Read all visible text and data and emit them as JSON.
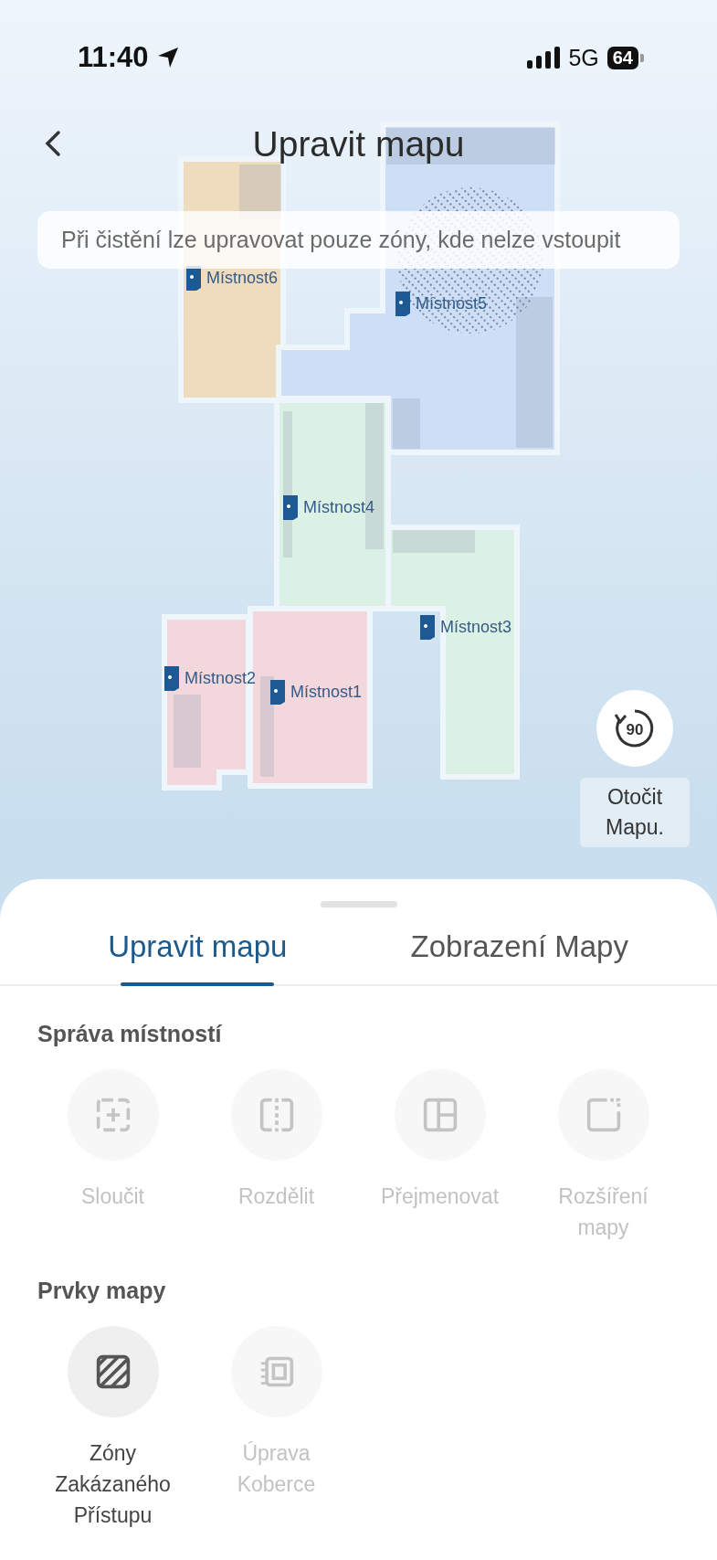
{
  "status_bar": {
    "time": "11:40",
    "network": "5G",
    "battery": "64"
  },
  "header": {
    "title": "Upravit mapu"
  },
  "notice": "Při čistění lze upravovat pouze zóny, kde nelze vstoupit",
  "map": {
    "rooms": [
      {
        "name": "Místnost6",
        "color": "#efdcbf"
      },
      {
        "name": "Místnost5",
        "color": "#cddff7"
      },
      {
        "name": "Místnost4",
        "color": "#dcf1e6"
      },
      {
        "name": "Místnost3",
        "color": "#dcf1e6"
      },
      {
        "name": "Místnost2",
        "color": "#f2d8dd"
      },
      {
        "name": "Místnost1",
        "color": "#f2d8dd"
      }
    ]
  },
  "rotate": {
    "badge": "90",
    "label": "Otočit Mapu."
  },
  "tabs": [
    {
      "label": "Upravit mapu",
      "selected": true
    },
    {
      "label": "Zobrazení Mapy",
      "selected": false
    }
  ],
  "sections": [
    {
      "title": "Správa místností",
      "tools": [
        {
          "label": "Sloučit",
          "kind": "merge",
          "disabled": true
        },
        {
          "label": "Rozdělit",
          "kind": "split",
          "disabled": true
        },
        {
          "label": "Přejmenovat",
          "kind": "rename",
          "disabled": true
        },
        {
          "label": "Rozšíření mapy",
          "kind": "expand",
          "disabled": true
        }
      ]
    },
    {
      "title": "Prvky mapy",
      "tools": [
        {
          "label": "Zóny Zakázaného Přístupu",
          "kind": "nogo",
          "disabled": false
        },
        {
          "label": "Úprava Koberce",
          "kind": "carpet",
          "disabled": true
        }
      ]
    }
  ]
}
